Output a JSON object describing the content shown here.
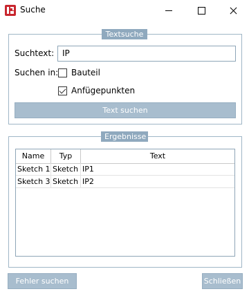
{
  "window": {
    "title": "Suche"
  },
  "textsuche": {
    "legend": "Textsuche",
    "suchtext_label": "Suchtext:",
    "suchtext_value": "IP",
    "suchen_in_label": "Suchen in:",
    "option_bauteil": {
      "label": "Bauteil",
      "checked": false
    },
    "option_anfuegepunkten": {
      "label": "Anfügepunkten",
      "checked": true
    },
    "search_button": "Text suchen"
  },
  "ergebnisse": {
    "legend": "Ergebnisse",
    "columns": [
      "Name",
      "Typ",
      "Text"
    ],
    "rows": [
      [
        "Sketch 1",
        "Sketch",
        "IP1"
      ],
      [
        "Sketch 3",
        "Sketch",
        "IP2"
      ]
    ]
  },
  "footer": {
    "fehler_button": "Fehler suchen",
    "close_button": "Schließen"
  }
}
